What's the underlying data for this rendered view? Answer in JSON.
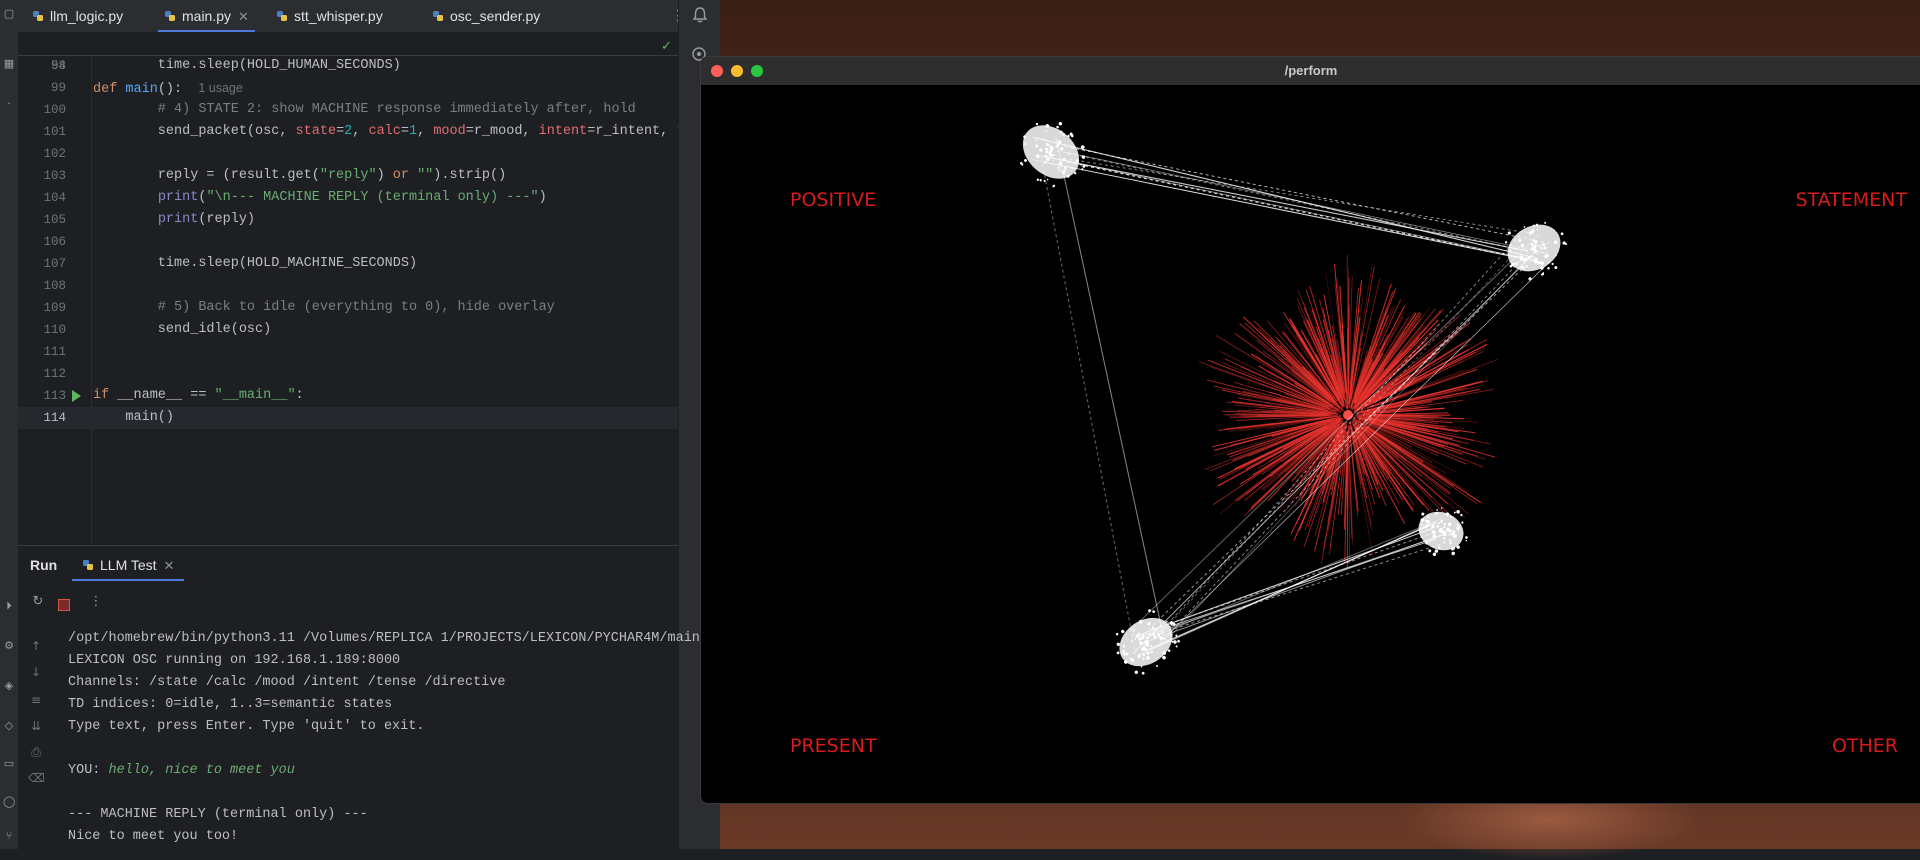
{
  "tabs": [
    {
      "label": "llm_logic.py"
    },
    {
      "label": "main.py",
      "active": true
    },
    {
      "label": "stt_whisper.py"
    },
    {
      "label": "osc_sender.py"
    }
  ],
  "editor": {
    "sticky_line_number": "54",
    "sticky_hint": "1 usage",
    "lines": [
      {
        "n": "98"
      },
      {
        "n": "99"
      },
      {
        "n": "100"
      },
      {
        "n": "101"
      },
      {
        "n": "102"
      },
      {
        "n": "103"
      },
      {
        "n": "104"
      },
      {
        "n": "105"
      },
      {
        "n": "106"
      },
      {
        "n": "107"
      },
      {
        "n": "108"
      },
      {
        "n": "109"
      },
      {
        "n": "110"
      },
      {
        "n": "111"
      },
      {
        "n": "112"
      },
      {
        "n": "113"
      },
      {
        "n": "114"
      }
    ]
  },
  "run_panel": {
    "label": "Run",
    "tab": "LLM Test",
    "console": [
      "/opt/homebrew/bin/python3.11 /Volumes/REPLICA 1/PROJECTS/LEXICON/PYCHAR4M/main.",
      "LEXICON OSC running on 192.168.1.189:8000",
      "Channels: /state /calc /mood /intent /tense /directive",
      "TD indices: 0=idle, 1..3=semantic states",
      "Type text, press Enter. Type 'quit' to exit.",
      "",
      "YOU: ",
      "",
      "--- MACHINE REPLY (terminal only) ---",
      "Nice to meet you too!"
    ],
    "user_input": "hello, nice to meet you"
  },
  "perform_window": {
    "title": "/perform",
    "quadrants": {
      "top_left": "POSITIVE",
      "top_right": "STATEMENT",
      "bottom_left": "PRESENT",
      "bottom_right": "OTHER"
    },
    "colors": {
      "label": "#d81b1b",
      "particles": "#e8332e",
      "nodes": "#ffffff"
    }
  }
}
